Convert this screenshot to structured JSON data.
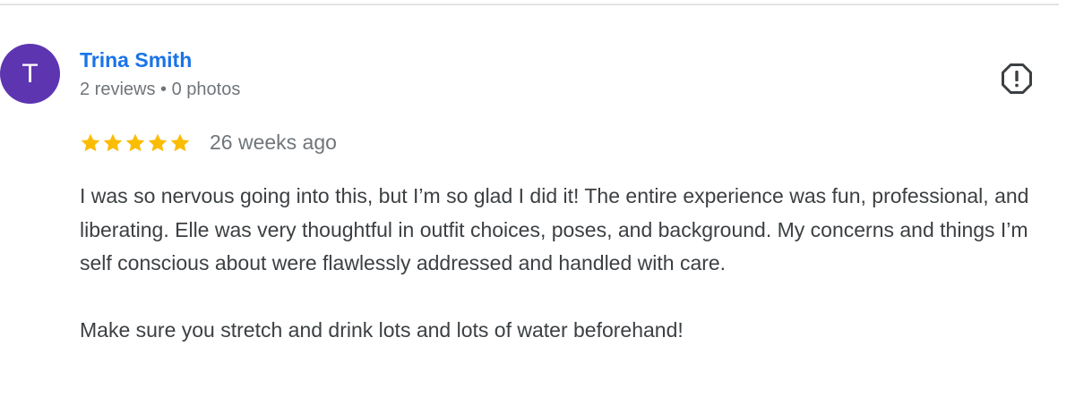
{
  "reviewer": {
    "initial": "T",
    "name": "Trina Smith",
    "meta": "2 reviews • 0 photos",
    "avatar_color": "#5e35b1"
  },
  "rating": {
    "stars": 5,
    "max_stars": 5,
    "star_color": "#fbbc04",
    "date": "26 weeks ago"
  },
  "review": {
    "paragraphs": [
      "I was so nervous going into this, but I’m so glad I did it! The entire experience was fun, professional, and liberating. Elle was very thoughtful in outfit choices, poses, and background. My concerns and things I’m self conscious about were flawlessly addressed and handled with care.",
      "Make sure you stretch and drink lots and lots of water beforehand!"
    ]
  },
  "icons": {
    "report": "report-flag-icon",
    "star": "star-icon"
  }
}
